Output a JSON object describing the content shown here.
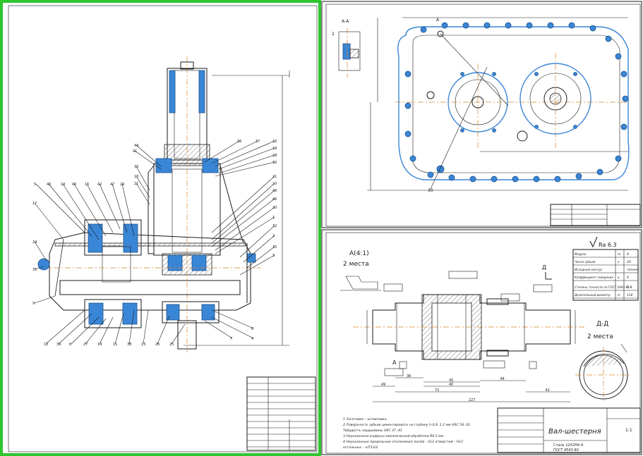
{
  "sheet1": {
    "balloons": [
      "44",
      "41",
      "33",
      "23",
      "22",
      "5",
      "45",
      "19",
      "40",
      "15",
      "42",
      "47",
      "29",
      "17",
      "24",
      "31",
      "9",
      "12",
      "39",
      "6",
      "27",
      "14",
      "11",
      "38",
      "13",
      "26",
      "36",
      "37",
      "16",
      "18",
      "28",
      "30",
      "21",
      "10",
      "48",
      "46",
      "20",
      "1",
      "32",
      "2",
      "35",
      "3",
      "8",
      "4",
      "7",
      "25"
    ]
  },
  "sheet2": {
    "section_label": "А-А",
    "balloon_2": "2",
    "balloon_30": "30",
    "cut_mark": "А"
  },
  "sheet3": {
    "detail_title": "А(4:1)",
    "detail_places": "2 места",
    "section_title": "Д-Д",
    "section_places": "2 места",
    "roughness": "Ra 6.3",
    "section_arrow": "Д",
    "datum": "А",
    "params_table": {
      "rows": [
        {
          "name": "Модуль",
          "sym": "m",
          "val": "4"
        },
        {
          "name": "Число зубьев",
          "sym": "z",
          "val": "29"
        },
        {
          "name": "Исходный контур",
          "sym": "-",
          "val": "типичн"
        },
        {
          "name": "Коэффициент смещения",
          "sym": "x",
          "val": "0"
        },
        {
          "name": "Степень точности по ГОСТ 1643-81",
          "sym": "-",
          "val": "7-В"
        },
        {
          "name": "Делительный диаметр",
          "sym": "d",
          "val": "116"
        }
      ]
    },
    "notes": [
      "1  Заготовка – штамповка",
      "2  Поверхность зубьев цементировать на глубину h-0.8..1.2 мм HRC 58..62",
      "   Твёрдость сердцевины HRC 37..41",
      "3  Неуказанные радиусы механической обработки R0.5 мм",
      "4  Неуказанные предельные отклонения: валов – h12 отверстий – H12",
      "   остальных – ±IT12/2"
    ],
    "dims_bottom": [
      "49",
      "72",
      "40",
      "42",
      "227"
    ],
    "dims_top": [
      "36",
      "40",
      "44"
    ],
    "part_title": "Вал-шестерня",
    "material": "Сталь 12Х2Н4 А",
    "material_std": "ГОСТ 4543-90",
    "sheet_scale": "1:1"
  }
}
